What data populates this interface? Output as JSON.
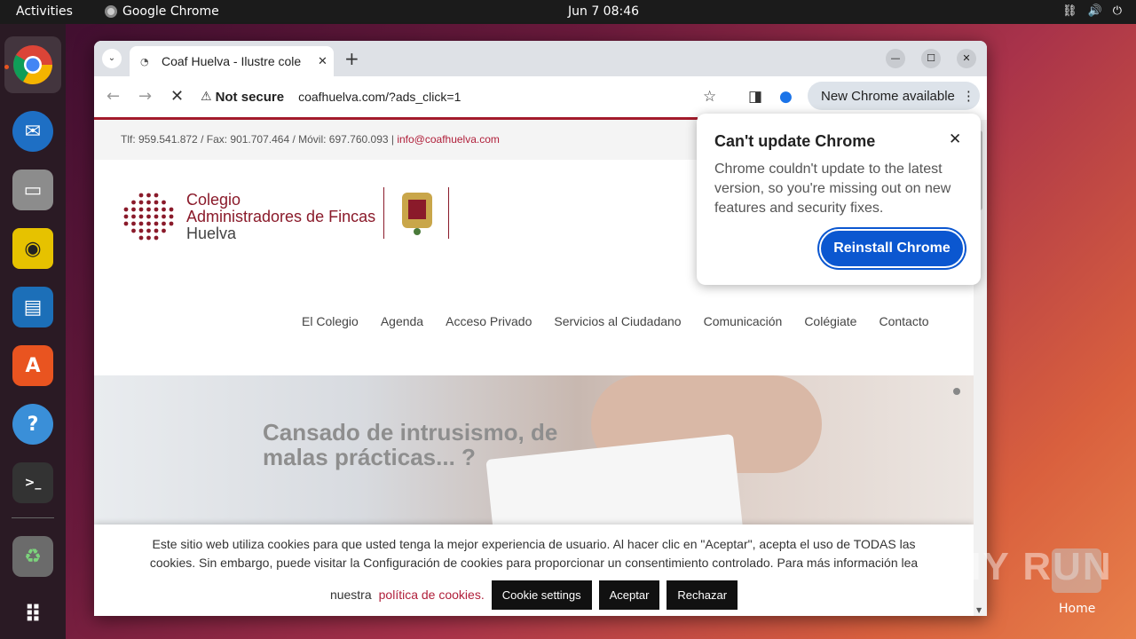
{
  "topbar": {
    "activities": "Activities",
    "app_name": "Google Chrome",
    "clock": "Jun 7  08:46",
    "tray": [
      "network-icon",
      "volume-icon",
      "power-icon"
    ]
  },
  "dock": {
    "apps": [
      "chrome-icon",
      "thunderbird-icon",
      "files-icon",
      "rhythmbox-icon",
      "writer-icon",
      "app-center-icon",
      "help-icon",
      "terminal-icon",
      "trash-icon",
      "show-apps-icon"
    ]
  },
  "browser": {
    "tab_title": "Coaf Huelva - Ilustre cole",
    "new_tab": "+",
    "omnibox": {
      "security": "Not secure",
      "url": "coafhuelva.com/?ads_click=1"
    },
    "update_pill": "New Chrome available"
  },
  "page": {
    "contact_line": "Tlf: 959.541.872 / Fax: 901.707.464 / Móvil: 697.760.093  |  ",
    "email": "info@coafhuelva.com",
    "logo": {
      "line1": "Colegio",
      "line2": "Administradores de Fincas",
      "line3": "Huelva"
    },
    "nav": [
      "El Colegio",
      "Agenda",
      "Acceso Privado",
      "Servicios al Ciudadano",
      "Comunicación",
      "Colégiate",
      "Contacto"
    ],
    "hero_headline_1": "Cansado de intrusismo, de",
    "hero_headline_2": "malas prácticas... ?"
  },
  "cookie": {
    "text1": "Este sitio web utiliza cookies para que usted tenga la mejor experiencia de usuario. Al hacer clic en \"Aceptar\", acepta el uso de TODAS las",
    "text2": "cookies. Sin embargo, puede visitar la Configuración de cookies para proporcionar un consentimiento controlado. Para más información lea",
    "text3": "nuestra",
    "link": "política de cookies.",
    "btn_settings": "Cookie settings",
    "btn_accept": "Aceptar",
    "btn_reject": "Rechazar"
  },
  "popup": {
    "title": "Can't update Chrome",
    "body": "Chrome couldn't update to the latest version, so you're missing out on new features and security fixes.",
    "button": "Reinstall Chrome"
  },
  "desktop": {
    "watermark": "ANY RUN",
    "home_label": "Home"
  },
  "colors": {
    "accent_red": "#a31b2b",
    "chrome_blue": "#0b57d0",
    "ubuntu_orange": "#e95420"
  }
}
